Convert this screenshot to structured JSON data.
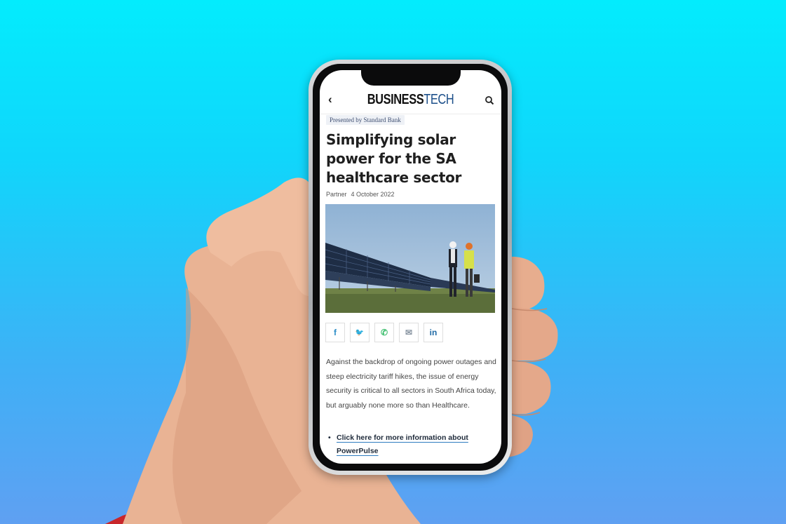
{
  "app": {
    "logo_part1": "BUSINESS",
    "logo_part2": "TECH",
    "back_icon": "chevron-left-icon",
    "search_icon": "search-icon"
  },
  "article": {
    "sponsor_badge": "Presented by Standard Bank",
    "title": "Simplifying solar power for the SA healthcare sector",
    "category": "Partner",
    "date": "4 October 2022",
    "body": "Against the backdrop of ongoing power outages and steep electricity tariff hikes, the issue of energy security is critical to all sectors in South Africa today, but arguably none more so than Healthcare.",
    "link_text": "Click here for more information about PowerPulse"
  },
  "share_buttons": [
    {
      "icon": "facebook-icon",
      "glyph": "f"
    },
    {
      "icon": "twitter-icon",
      "glyph": "🐦"
    },
    {
      "icon": "whatsapp-icon",
      "glyph": "✆"
    },
    {
      "icon": "email-icon",
      "glyph": "✉"
    },
    {
      "icon": "linkedin-icon",
      "glyph": "in"
    }
  ],
  "colors": {
    "brand_dark": "#111111",
    "brand_blue": "#1c4f8a",
    "share_icon": "#2d8ec8",
    "background_top": "#03ecfd",
    "background_bottom": "#5fa0f2"
  }
}
